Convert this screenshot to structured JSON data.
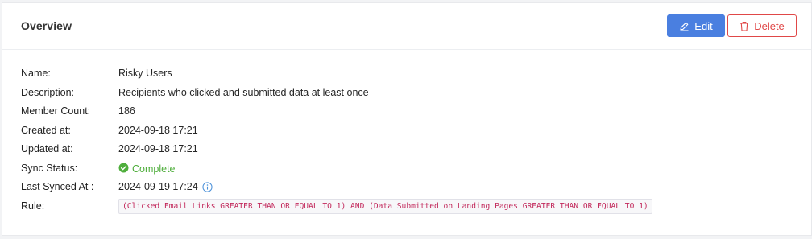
{
  "header": {
    "title": "Overview",
    "edit_label": "Edit",
    "delete_label": "Delete"
  },
  "details": {
    "name": {
      "label": "Name:",
      "value": "Risky Users"
    },
    "description": {
      "label": "Description:",
      "value": "Recipients who clicked and submitted data at least once"
    },
    "member_count": {
      "label": "Member Count:",
      "value": "186"
    },
    "created_at": {
      "label": "Created at:",
      "value": "2024-09-18 17:21"
    },
    "updated_at": {
      "label": "Updated at:",
      "value": "2024-09-18 17:21"
    },
    "sync_status": {
      "label": "Sync Status:",
      "value": "Complete"
    },
    "last_synced_at": {
      "label": "Last Synced At :",
      "value": "2024-09-19 17:24"
    },
    "rule": {
      "label": "Rule:",
      "value": "(Clicked Email Links GREATER THAN OR EQUAL TO 1) AND (Data Submitted on Landing Pages GREATER THAN OR EQUAL TO 1)"
    }
  },
  "colors": {
    "primary": "#4a7fe0",
    "danger": "#e04848",
    "success": "#4fae3c",
    "info": "#4a90d9",
    "code": "#c2285b"
  },
  "icons": {
    "edit": "pencil-icon",
    "delete": "trash-icon",
    "status": "check-circle-icon",
    "info": "info-circle-icon"
  }
}
